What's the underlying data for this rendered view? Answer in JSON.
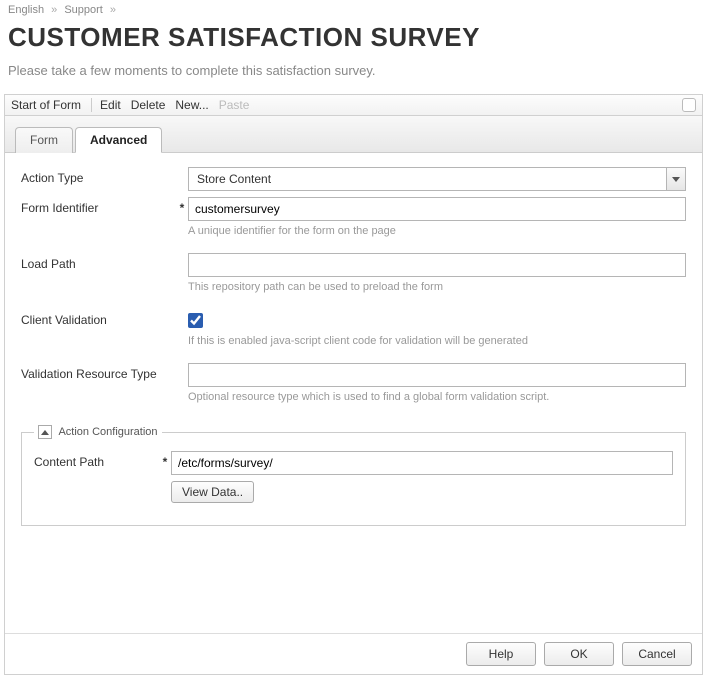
{
  "breadcrumb": {
    "lang": "English",
    "section": "Support"
  },
  "page": {
    "title": "CUSTOMER SATISFACTION SURVEY",
    "intro": "Please take a few moments to complete this satisfaction survey."
  },
  "toolbar": {
    "start_of_form": "Start of Form",
    "edit": "Edit",
    "delete": "Delete",
    "new": "New...",
    "paste": "Paste"
  },
  "tabs": {
    "form": "Form",
    "advanced": "Advanced"
  },
  "labels": {
    "action_type": "Action Type",
    "form_identifier": "Form Identifier",
    "load_path": "Load Path",
    "client_validation": "Client Validation",
    "validation_resource_type": "Validation Resource Type",
    "action_configuration": "Action Configuration",
    "content_path": "Content Path"
  },
  "values": {
    "action_type": "Store Content",
    "form_identifier": "customersurvey",
    "load_path": "",
    "client_validation": true,
    "validation_resource_type": "",
    "content_path": "/etc/forms/survey/"
  },
  "hints": {
    "form_identifier": "A unique identifier for the form on the page",
    "load_path": "This repository path can be used to preload the form",
    "client_validation": "If this is enabled java-script client code for validation will be generated",
    "validation_resource_type": "Optional resource type which is used to find a global form validation script."
  },
  "buttons": {
    "view_data": "View Data..",
    "help": "Help",
    "ok": "OK",
    "cancel": "Cancel"
  }
}
